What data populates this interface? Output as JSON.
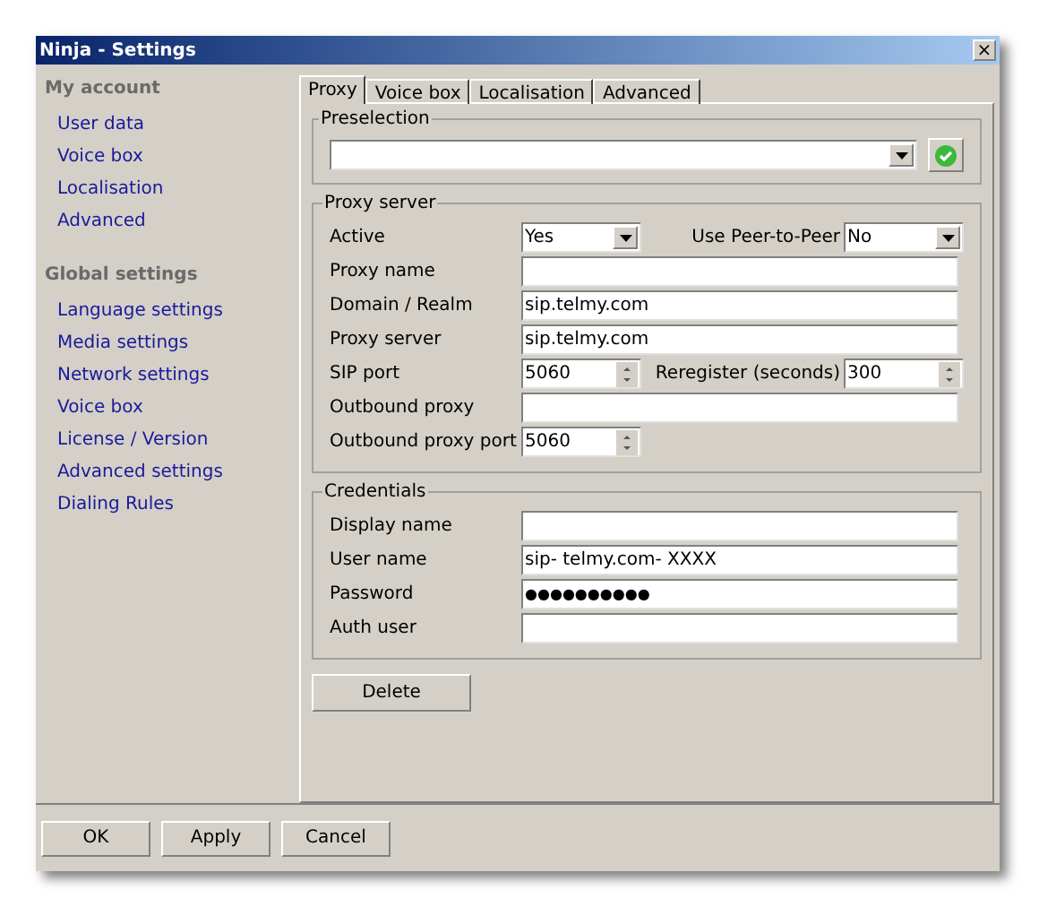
{
  "window": {
    "title": "Ninja - Settings",
    "close": "×"
  },
  "sidebar": {
    "sections": [
      {
        "title": "My account",
        "items": [
          "User data",
          "Voice box",
          "Localisation",
          "Advanced"
        ]
      },
      {
        "title": "Global settings",
        "items": [
          "Language settings",
          "Media settings",
          "Network settings",
          "Voice box",
          "License / Version",
          "Advanced settings",
          "Dialing Rules"
        ]
      }
    ]
  },
  "tabs": [
    {
      "label": "Proxy",
      "selected": true
    },
    {
      "label": "Voice box",
      "selected": false
    },
    {
      "label": "Localisation",
      "selected": false
    },
    {
      "label": "Advanced",
      "selected": false
    }
  ],
  "preselection": {
    "title": "Preselection"
  },
  "groups": [
    {
      "title": "Proxy server",
      "rows": [
        [
          {
            "label": "Active",
            "kind": "select",
            "value": "Yes"
          },
          {
            "label": "Use Peer-to-Peer",
            "kind": "select",
            "value": "No"
          }
        ],
        [
          {
            "label": "Proxy name",
            "kind": "text"
          }
        ],
        [
          {
            "label": "Domain / Realm",
            "kind": "text",
            "value": "sip.telmy.com"
          }
        ],
        [
          {
            "label": "Proxy server",
            "kind": "text",
            "value": "sip.telmy.com"
          }
        ],
        [
          {
            "label": "SIP port",
            "kind": "spin",
            "value": "5060"
          },
          {
            "label": "Reregister (seconds)",
            "kind": "spin",
            "value": "300"
          }
        ],
        [
          {
            "label": "Outbound proxy",
            "kind": "text"
          }
        ],
        [
          {
            "label": "Outbound proxy port",
            "kind": "spin",
            "value": "5060"
          }
        ]
      ]
    },
    {
      "title": "Credentials",
      "rows": [
        [
          {
            "label": "Display name",
            "kind": "text"
          }
        ],
        [
          {
            "label": "User name",
            "kind": "text",
            "value": "sip- telmy.com- XXXX"
          }
        ],
        [
          {
            "label": "Password",
            "kind": "password",
            "value": "●●●●●●●●●●"
          }
        ],
        [
          {
            "label": "Auth user",
            "kind": "text"
          }
        ]
      ]
    }
  ],
  "delete_button": "Delete",
  "buttons": [
    "OK",
    "Apply",
    "Cancel"
  ]
}
